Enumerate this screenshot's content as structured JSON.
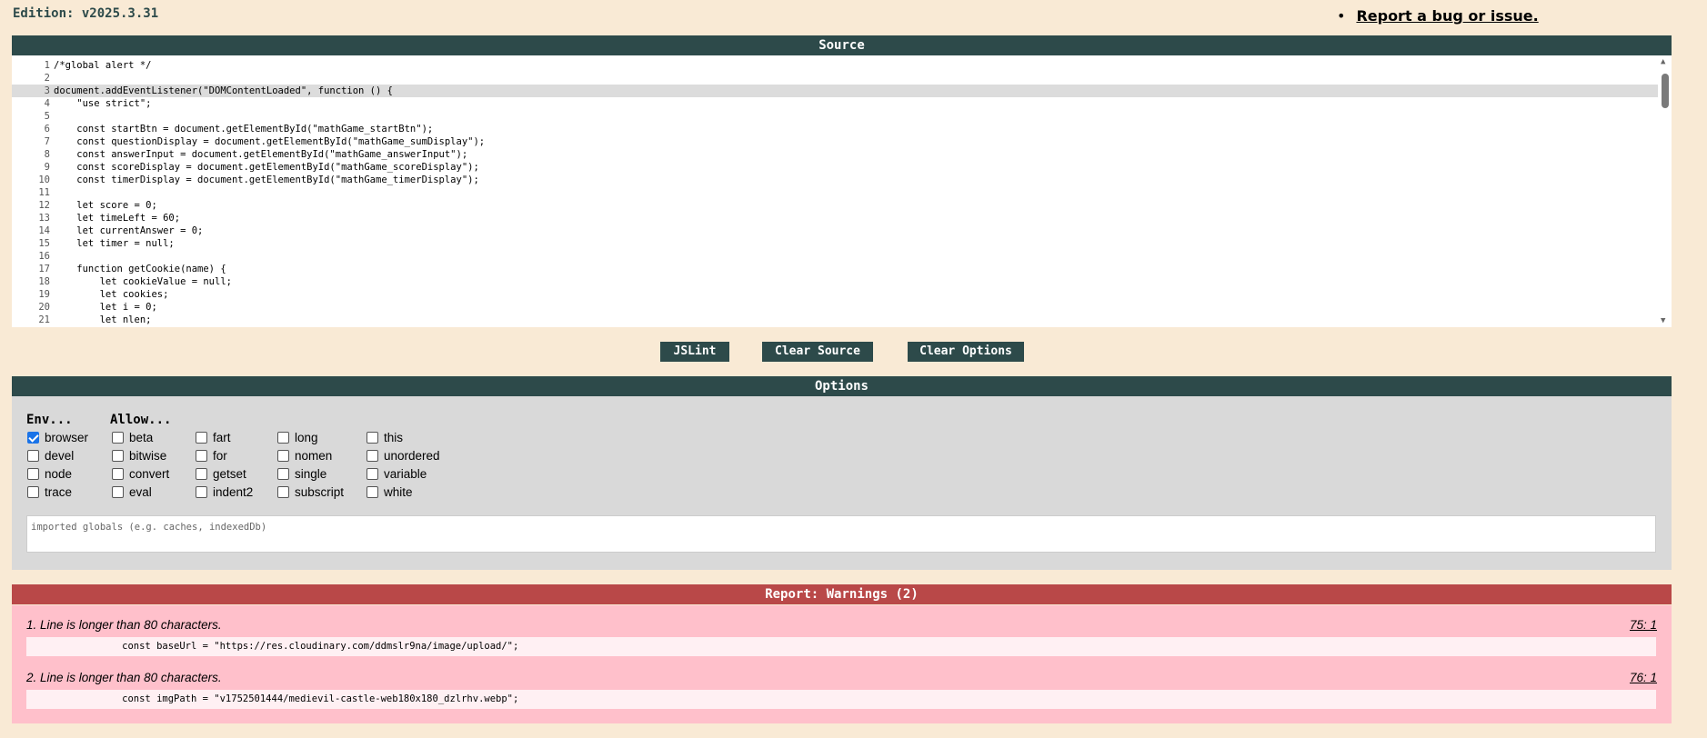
{
  "header": {
    "edition": "Edition: v2025.3.31",
    "bug_link": "Report a bug or issue."
  },
  "source": {
    "title": "Source",
    "lines": [
      {
        "n": "1",
        "code": "/*global alert */"
      },
      {
        "n": "2",
        "code": ""
      },
      {
        "n": "3",
        "code": "document.addEventListener(\"DOMContentLoaded\", function () {"
      },
      {
        "n": "4",
        "code": "    \"use strict\";"
      },
      {
        "n": "5",
        "code": ""
      },
      {
        "n": "6",
        "code": "    const startBtn = document.getElementById(\"mathGame_startBtn\");"
      },
      {
        "n": "7",
        "code": "    const questionDisplay = document.getElementById(\"mathGame_sumDisplay\");"
      },
      {
        "n": "8",
        "code": "    const answerInput = document.getElementById(\"mathGame_answerInput\");"
      },
      {
        "n": "9",
        "code": "    const scoreDisplay = document.getElementById(\"mathGame_scoreDisplay\");"
      },
      {
        "n": "10",
        "code": "    const timerDisplay = document.getElementById(\"mathGame_timerDisplay\");"
      },
      {
        "n": "11",
        "code": ""
      },
      {
        "n": "12",
        "code": "    let score = 0;"
      },
      {
        "n": "13",
        "code": "    let timeLeft = 60;"
      },
      {
        "n": "14",
        "code": "    let currentAnswer = 0;"
      },
      {
        "n": "15",
        "code": "    let timer = null;"
      },
      {
        "n": "16",
        "code": ""
      },
      {
        "n": "17",
        "code": "    function getCookie(name) {"
      },
      {
        "n": "18",
        "code": "        let cookieValue = null;"
      },
      {
        "n": "19",
        "code": "        let cookies;"
      },
      {
        "n": "20",
        "code": "        let i = 0;"
      },
      {
        "n": "21",
        "code": "        let nlen;"
      }
    ]
  },
  "buttons": {
    "jslint": "JSLint",
    "clear_source": "Clear Source",
    "clear_options": "Clear Options"
  },
  "options": {
    "title": "Options",
    "env_label": "Env...",
    "allow_label": "Allow...",
    "env": [
      {
        "label": "browser",
        "checked": true
      },
      {
        "label": "devel",
        "checked": false
      },
      {
        "label": "node",
        "checked": false
      },
      {
        "label": "trace",
        "checked": false
      }
    ],
    "allow_cols": [
      [
        "beta",
        "bitwise",
        "convert",
        "eval"
      ],
      [
        "fart",
        "for",
        "getset",
        "indent2"
      ],
      [
        "long",
        "nomen",
        "single",
        "subscript"
      ],
      [
        "this",
        "unordered",
        "variable",
        "white"
      ]
    ],
    "globals_placeholder": "imported globals (e.g. caches, indexedDb)"
  },
  "report": {
    "title": "Report: Warnings (2)",
    "warnings": [
      {
        "title": "1. Line is longer than 80 characters.",
        "loc": "75: 1",
        "code": "                const baseUrl = \"https://res.cloudinary.com/ddmslr9na/image/upload/\";"
      },
      {
        "title": "2. Line is longer than 80 characters.",
        "loc": "76: 1",
        "code": "                const imgPath = \"v1752501444/medievil-castle-web180x180_dzlrhv.webp\";"
      }
    ]
  }
}
